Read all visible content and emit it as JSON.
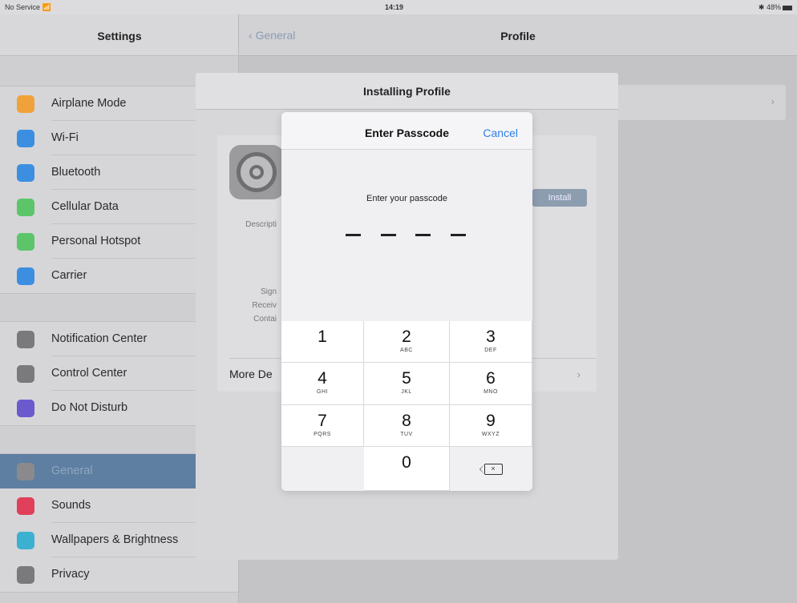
{
  "status_bar": {
    "carrier": "No Service",
    "wifi_icon": "wifi-icon",
    "time": "14:19",
    "battery": "48%"
  },
  "settings": {
    "title": "Settings",
    "groups": [
      [
        {
          "label": "Airplane Mode",
          "icon": "airplane-icon",
          "color": "#f0a23a"
        },
        {
          "label": "Wi-Fi",
          "icon": "wifi-icon",
          "color": "#3c8fe0"
        },
        {
          "label": "Bluetooth",
          "icon": "bluetooth-icon",
          "color": "#3c8fe0"
        },
        {
          "label": "Cellular Data",
          "icon": "antenna-icon",
          "color": "#5cc569"
        },
        {
          "label": "Personal Hotspot",
          "icon": "hotspot-icon",
          "color": "#5cc569"
        },
        {
          "label": "Carrier",
          "icon": "phone-icon",
          "color": "#3c8fe0"
        }
      ],
      [
        {
          "label": "Notification Center",
          "icon": "notification-icon",
          "color": "#7a7a7d"
        },
        {
          "label": "Control Center",
          "icon": "control-center-icon",
          "color": "#7a7a7d"
        },
        {
          "label": "Do Not Disturb",
          "icon": "moon-icon",
          "color": "#6a5acd"
        }
      ],
      [
        {
          "label": "General",
          "icon": "gear-icon",
          "color": "#8a8a8d",
          "selected": true
        },
        {
          "label": "Sounds",
          "icon": "speaker-icon",
          "color": "#e0405a"
        },
        {
          "label": "Wallpapers & Brightness",
          "icon": "flower-icon",
          "color": "#3cb0d0"
        },
        {
          "label": "Privacy",
          "icon": "hand-icon",
          "color": "#7a7a7d"
        }
      ]
    ]
  },
  "detail": {
    "back_label": "General",
    "title": "Profile"
  },
  "install_modal": {
    "title": "Installing Profile",
    "install_button": "Install",
    "labels": {
      "description": "Descripti",
      "signed": "Sign",
      "received": "Receiv",
      "contains": "Contai"
    },
    "more_details": "More De"
  },
  "passcode": {
    "title": "Enter Passcode",
    "cancel": "Cancel",
    "prompt": "Enter your passcode",
    "digits_entered": 0,
    "length": 4,
    "keys": [
      {
        "num": "1",
        "letters": ""
      },
      {
        "num": "2",
        "letters": "ABC"
      },
      {
        "num": "3",
        "letters": "DEF"
      },
      {
        "num": "4",
        "letters": "GHI"
      },
      {
        "num": "5",
        "letters": "JKL"
      },
      {
        "num": "6",
        "letters": "MNO"
      },
      {
        "num": "7",
        "letters": "PQRS"
      },
      {
        "num": "8",
        "letters": "TUV"
      },
      {
        "num": "9",
        "letters": "WXYZ"
      },
      {
        "num": "0",
        "letters": ""
      }
    ]
  }
}
